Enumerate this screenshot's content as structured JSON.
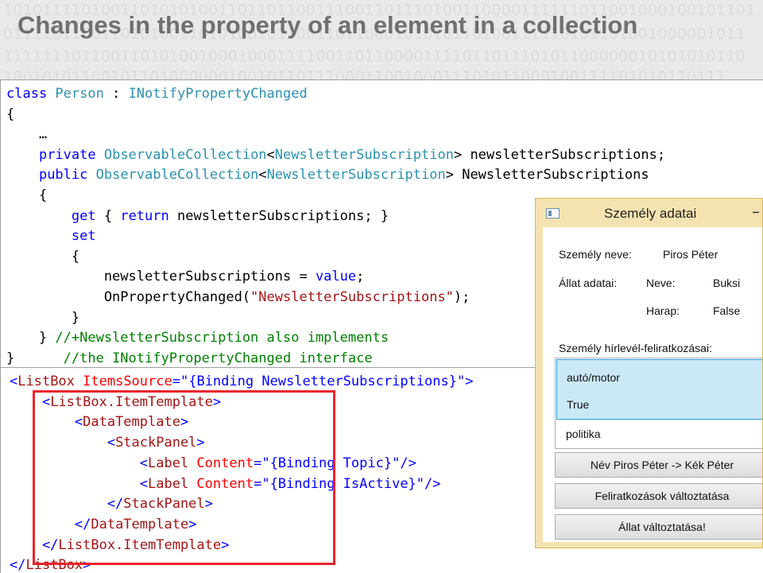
{
  "slide": {
    "title": "Changes in the property of an element in a collection",
    "background_binary": [
      "10101111010011010101001101101100111001101110100110000111111011001000100101101",
      "0111101100110101001101010010110011011000101010110100111110101101001000001011",
      "1111111011001101010010001000111100110110000111101101110101100000010101010110",
      "10010101100101101000000100101101110001100100011101011000100111101010110111"
    ]
  },
  "csharp_code": {
    "lines": [
      [
        {
          "t": "class ",
          "s": "k"
        },
        {
          "t": "Person",
          "s": "t"
        },
        {
          "t": " : ",
          "s": ""
        },
        {
          "t": "INotifyPropertyChanged",
          "s": "t"
        }
      ],
      [
        {
          "t": "{",
          "s": ""
        }
      ],
      [
        {
          "t": "    …",
          "s": ""
        }
      ],
      [
        {
          "t": "    ",
          "s": ""
        },
        {
          "t": "private ",
          "s": "k"
        },
        {
          "t": "ObservableCollection",
          "s": "t"
        },
        {
          "t": "<",
          "s": ""
        },
        {
          "t": "NewsletterSubscription",
          "s": "t"
        },
        {
          "t": "> newsletterSubscriptions;",
          "s": ""
        }
      ],
      [
        {
          "t": "    ",
          "s": ""
        },
        {
          "t": "public ",
          "s": "k"
        },
        {
          "t": "ObservableCollection",
          "s": "t"
        },
        {
          "t": "<",
          "s": ""
        },
        {
          "t": "NewsletterSubscription",
          "s": "t"
        },
        {
          "t": "> NewsletterSubscriptions",
          "s": ""
        }
      ],
      [
        {
          "t": "    {",
          "s": ""
        }
      ],
      [
        {
          "t": "        ",
          "s": ""
        },
        {
          "t": "get",
          "s": "k"
        },
        {
          "t": " { ",
          "s": ""
        },
        {
          "t": "return",
          "s": "k"
        },
        {
          "t": " newsletterSubscriptions; }",
          "s": ""
        }
      ],
      [
        {
          "t": "        ",
          "s": ""
        },
        {
          "t": "set",
          "s": "k"
        }
      ],
      [
        {
          "t": "        {",
          "s": ""
        }
      ],
      [
        {
          "t": "            newsletterSubscriptions = ",
          "s": ""
        },
        {
          "t": "value",
          "s": "k"
        },
        {
          "t": ";",
          "s": ""
        }
      ],
      [
        {
          "t": "            OnPropertyChanged(",
          "s": ""
        },
        {
          "t": "\"NewsletterSubscriptions\"",
          "s": "s"
        },
        {
          "t": ");",
          "s": ""
        }
      ],
      [
        {
          "t": "        }",
          "s": ""
        }
      ],
      [
        {
          "t": "    } ",
          "s": ""
        },
        {
          "t": "//+NewsletterSubscription also implements",
          "s": "c"
        }
      ],
      [
        {
          "t": "}      ",
          "s": ""
        },
        {
          "t": "//the INotifyPropertyChanged interface",
          "s": "c"
        }
      ]
    ]
  },
  "xaml_code": {
    "lines": [
      [
        {
          "t": "<",
          "s": "xb"
        },
        {
          "t": "ListBox",
          "s": "xm"
        },
        {
          "t": " ItemsSource",
          "s": "xr"
        },
        {
          "t": "=\"",
          "s": "xb"
        },
        {
          "t": "{Binding NewsletterSubscriptions}",
          "s": "xb"
        },
        {
          "t": "\">",
          "s": "xb"
        }
      ],
      [
        {
          "t": "    <",
          "s": "xb"
        },
        {
          "t": "ListBox.ItemTemplate",
          "s": "xm"
        },
        {
          "t": ">",
          "s": "xb"
        }
      ],
      [
        {
          "t": "        <",
          "s": "xb"
        },
        {
          "t": "DataTemplate",
          "s": "xm"
        },
        {
          "t": ">",
          "s": "xb"
        }
      ],
      [
        {
          "t": "            <",
          "s": "xb"
        },
        {
          "t": "StackPanel",
          "s": "xm"
        },
        {
          "t": ">",
          "s": "xb"
        }
      ],
      [
        {
          "t": "                <",
          "s": "xb"
        },
        {
          "t": "Label",
          "s": "xm"
        },
        {
          "t": " Content",
          "s": "xr"
        },
        {
          "t": "=\"",
          "s": "xb"
        },
        {
          "t": "{Binding Topic}",
          "s": "xb"
        },
        {
          "t": "\"/>",
          "s": "xb"
        }
      ],
      [
        {
          "t": "                <",
          "s": "xb"
        },
        {
          "t": "Label",
          "s": "xm"
        },
        {
          "t": " Content",
          "s": "xr"
        },
        {
          "t": "=\"",
          "s": "xb"
        },
        {
          "t": "{Binding IsActive}",
          "s": "xb"
        },
        {
          "t": "\"/>",
          "s": "xb"
        }
      ],
      [
        {
          "t": "            </",
          "s": "xb"
        },
        {
          "t": "StackPanel",
          "s": "xm"
        },
        {
          "t": ">",
          "s": "xb"
        }
      ],
      [
        {
          "t": "        </",
          "s": "xb"
        },
        {
          "t": "DataTemplate",
          "s": "xm"
        },
        {
          "t": ">",
          "s": "xb"
        }
      ],
      [
        {
          "t": "    </",
          "s": "xb"
        },
        {
          "t": "ListBox.ItemTemplate",
          "s": "xm"
        },
        {
          "t": ">",
          "s": "xb"
        }
      ],
      [
        {
          "t": "</",
          "s": "xb"
        },
        {
          "t": "ListBox",
          "s": "xm"
        },
        {
          "t": ">",
          "s": "xb"
        }
      ]
    ]
  },
  "window": {
    "title": "Személy adatai",
    "minimize_glyph": "–",
    "person_name_label": "Személy neve:",
    "person_name_value": "Piros Péter",
    "animal_label": "Állat adatai:",
    "animal_name_label": "Neve:",
    "animal_name_value": "Buksi",
    "animal_paw_label": "Harap:",
    "animal_paw_value": "False",
    "subscriptions_label": "Személy hírlevél-feliratkozásai:",
    "list_items": [
      {
        "topic": "autó/motor",
        "is_active": "True",
        "selected": true
      },
      {
        "topic": "politika",
        "selected": false
      }
    ],
    "buttons": {
      "rename": "Név Piros Péter -> Kék Péter",
      "change_subscriptions": "Feliratkozások változtatása",
      "change_animal": "Állat változtatása!"
    }
  },
  "colors": {
    "keyword": "#0000ff",
    "type": "#2b91af",
    "string": "#a31515",
    "comment": "#008000",
    "highlight": "#e8262c",
    "window_frame": "#f4e3b0"
  }
}
